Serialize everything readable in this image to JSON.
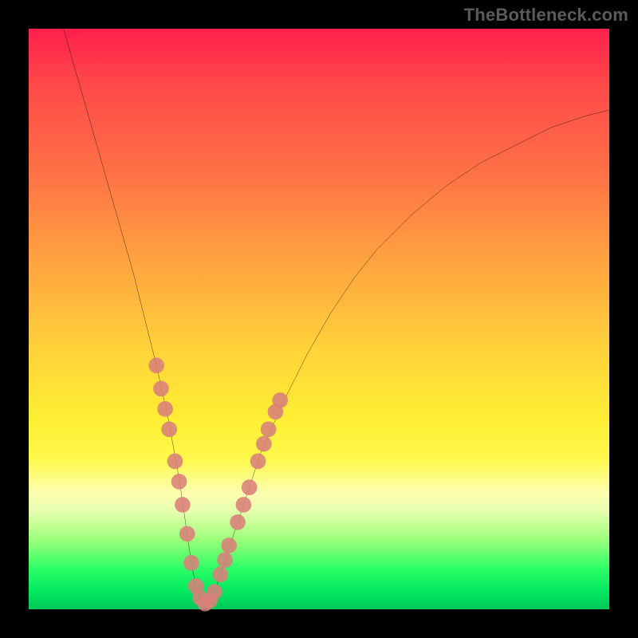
{
  "watermark": "TheBottleneck.com",
  "colors": {
    "frame": "#000000",
    "gradient_top": "#ff1f4b",
    "gradient_mid": "#ffd23a",
    "gradient_bottom": "#00c858",
    "curve": "#000000",
    "markers": "#d97f7a"
  },
  "chart_data": {
    "type": "line",
    "title": "",
    "xlabel": "",
    "ylabel": "",
    "xlim": [
      0,
      100
    ],
    "ylim": [
      0,
      100
    ],
    "series": [
      {
        "name": "bottleneck-curve",
        "x": [
          6,
          8,
          10,
          12,
          14,
          16,
          18,
          20,
          22,
          24,
          26,
          27,
          28,
          29,
          30,
          31,
          32,
          34,
          36,
          38,
          40,
          44,
          48,
          52,
          56,
          60,
          66,
          72,
          78,
          84,
          90,
          96,
          100
        ],
        "y": [
          100,
          93,
          86,
          79,
          72,
          65,
          58,
          50,
          42,
          33,
          22,
          15,
          8,
          3,
          1,
          1,
          3,
          9,
          15,
          21,
          27,
          36,
          44,
          51,
          57,
          62,
          68,
          73,
          77,
          80,
          83,
          85,
          86
        ]
      }
    ],
    "markers": {
      "name": "highlight-points",
      "points": [
        {
          "x": 22.0,
          "y": 42.0
        },
        {
          "x": 22.8,
          "y": 38.0
        },
        {
          "x": 23.5,
          "y": 34.5
        },
        {
          "x": 24.2,
          "y": 31.0
        },
        {
          "x": 25.2,
          "y": 25.5
        },
        {
          "x": 25.9,
          "y": 22.0
        },
        {
          "x": 26.5,
          "y": 18.0
        },
        {
          "x": 27.3,
          "y": 13.0
        },
        {
          "x": 28.0,
          "y": 8.0
        },
        {
          "x": 28.8,
          "y": 4.0
        },
        {
          "x": 29.5,
          "y": 2.0
        },
        {
          "x": 30.4,
          "y": 1.0
        },
        {
          "x": 31.2,
          "y": 1.5
        },
        {
          "x": 32.0,
          "y": 3.0
        },
        {
          "x": 33.0,
          "y": 6.0
        },
        {
          "x": 33.8,
          "y": 8.5
        },
        {
          "x": 34.5,
          "y": 11.0
        },
        {
          "x": 36.0,
          "y": 15.0
        },
        {
          "x": 37.0,
          "y": 18.0
        },
        {
          "x": 38.0,
          "y": 21.0
        },
        {
          "x": 39.5,
          "y": 25.5
        },
        {
          "x": 40.5,
          "y": 28.5
        },
        {
          "x": 41.3,
          "y": 31.0
        },
        {
          "x": 42.5,
          "y": 34.0
        },
        {
          "x": 43.3,
          "y": 36.0
        }
      ]
    }
  }
}
